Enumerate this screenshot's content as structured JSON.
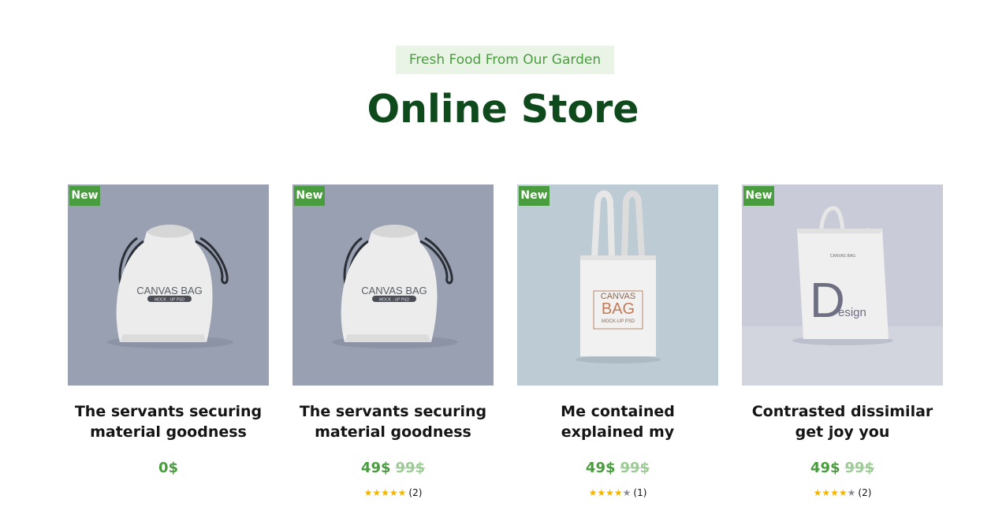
{
  "header": {
    "tagline": "Fresh Food From Our Garden",
    "title": "Online Store"
  },
  "colors": {
    "accent": "#4a9d3e",
    "title": "#0f4a1c",
    "tagline_bg": "#e9f4e7",
    "star": "#f5b400"
  },
  "products": [
    {
      "badge": "New",
      "image": "drawstring-canvas-bag",
      "image_text": "CANVAS BAG",
      "image_subtext": "MOCK - UP PSD",
      "title_line1": "The servants securing",
      "title_line2": "material goodness",
      "price": "0$",
      "old_price": "",
      "rating": 0,
      "reviews": ""
    },
    {
      "badge": "New",
      "image": "drawstring-canvas-bag",
      "image_text": "CANVAS BAG",
      "image_subtext": "MOCK - UP PSD",
      "title_line1": "The servants securing",
      "title_line2": "material goodness",
      "price": "49$",
      "old_price": "99$",
      "rating": 5,
      "reviews": "(2)"
    },
    {
      "badge": "New",
      "image": "canvas-tote-bag",
      "image_text_1": "CANVAS",
      "image_text_2": "BAG",
      "image_subtext": "MOCK-UP PSD",
      "title_line1": "Me contained",
      "title_line2": "explained my",
      "price": "49$",
      "old_price": "99$",
      "rating": 4,
      "reviews": "(1)"
    },
    {
      "badge": "New",
      "image": "design-tote-bag",
      "image_text_1": "D",
      "image_text_2": "esign",
      "image_subtext": "CANVAS BAG",
      "title_line1": "Contrasted dissimilar",
      "title_line2": "get joy you",
      "price": "49$",
      "old_price": "99$",
      "rating": 4,
      "reviews": "(2)"
    }
  ]
}
